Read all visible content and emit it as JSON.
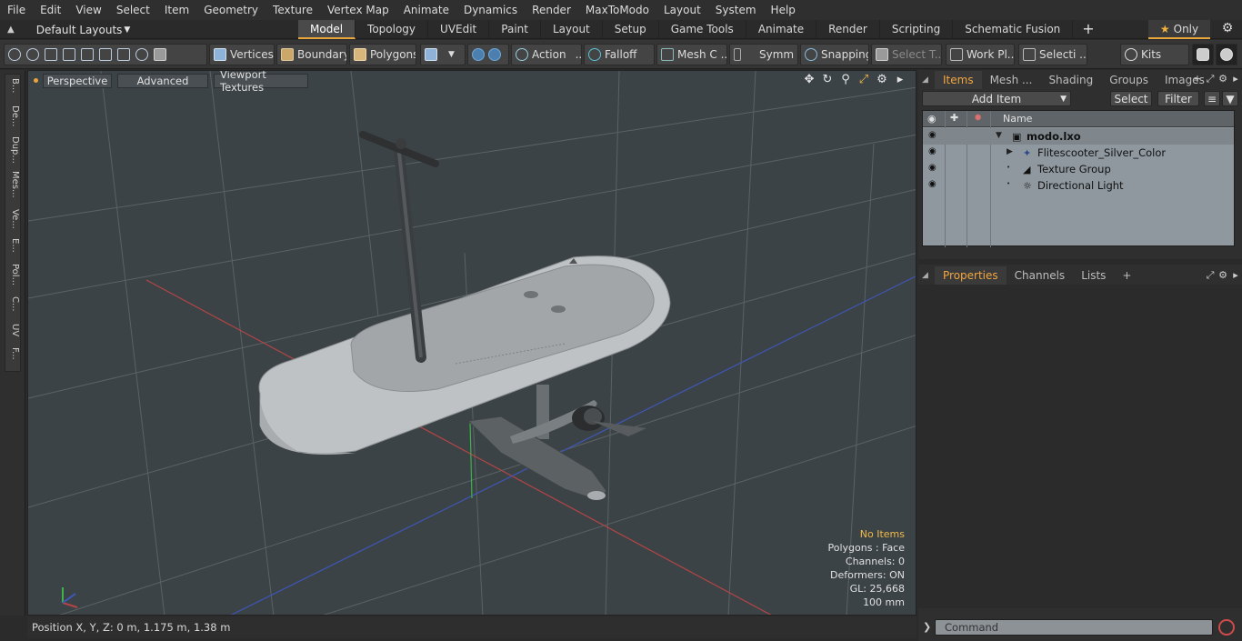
{
  "menu": [
    "File",
    "Edit",
    "View",
    "Select",
    "Item",
    "Geometry",
    "Texture",
    "Vertex Map",
    "Animate",
    "Dynamics",
    "Render",
    "MaxToModo",
    "Layout",
    "System",
    "Help"
  ],
  "layouts_label": "Default Layouts",
  "layout_tabs": [
    "Model",
    "Topology",
    "UVEdit",
    "Paint",
    "Layout",
    "Setup",
    "Game Tools",
    "Animate",
    "Render",
    "Scripting",
    "Schematic Fusion"
  ],
  "active_layout_tab": "Model",
  "only_label": "Only",
  "toolbar": {
    "vertices": "Vertices",
    "boundary": "Boundary",
    "polygons": "Polygons",
    "action": "Action",
    "falloff": "Falloff",
    "mesh_c": "Mesh C ...",
    "symm": "Symm ...",
    "snapping": "Snapping",
    "select_t": "Select T...",
    "work_pl": "Work Pl...",
    "selecti": "Selecti ...",
    "kits": "Kits"
  },
  "left_tabs": [
    "B...",
    "De...",
    "Dup...",
    "Mes...",
    "Ve...",
    "E...",
    "Pol...",
    "C...",
    "UV",
    "F..."
  ],
  "viewport": {
    "perspective": "Perspective",
    "advanced": "Advanced",
    "viewport_textures": "Viewport Textures",
    "stats": {
      "no_items": "No Items",
      "polygons": "Polygons : Face",
      "channels": "Channels: 0",
      "deformers": "Deformers: ON",
      "gl": "GL: 25,668",
      "scale": "100 mm"
    }
  },
  "status": "Position X, Y, Z:   0 m, 1.175 m, 1.38 m",
  "items_panel": {
    "tabs": [
      "Items",
      "Mesh ...",
      "Shading",
      "Groups",
      "Images"
    ],
    "active_tab": "Items",
    "add_item": "Add Item",
    "select": "Select",
    "filter": "Filter",
    "name_header": "Name",
    "tree": [
      {
        "name": "modo.lxo",
        "bold": true
      },
      {
        "name": "Flitescooter_Silver_Color"
      },
      {
        "name": "Texture Group"
      },
      {
        "name": "Directional Light"
      }
    ]
  },
  "props_panel": {
    "tabs": [
      "Properties",
      "Channels",
      "Lists"
    ],
    "active_tab": "Properties"
  },
  "command_placeholder": "Command",
  "colors": {
    "accent": "#e8a53b",
    "viewport_bg": "#3c4347",
    "list_bg": "#8f989e"
  }
}
